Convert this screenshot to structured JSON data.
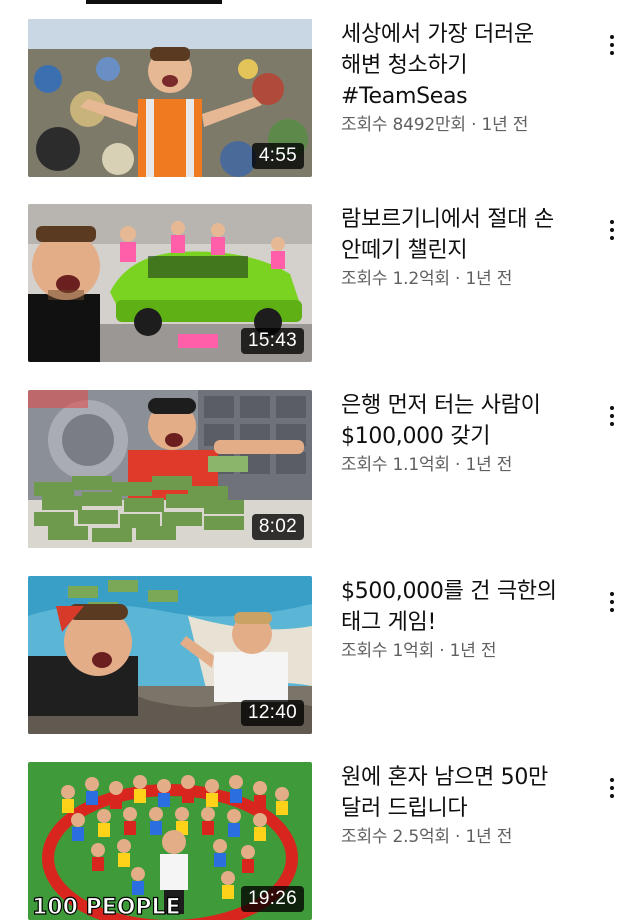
{
  "videos": [
    {
      "title_lines": [
        "세상에서 가장 더러운",
        "해변 청소하기",
        "#TeamSeas"
      ],
      "views": "조회수 8492만회",
      "age": "1년 전",
      "duration": "4:55",
      "more_icon": "more-vert-icon"
    },
    {
      "title_lines": [
        "람보르기니에서 절대 손",
        "안떼기 챌린지"
      ],
      "views": "조회수 1.2억회",
      "age": "1년 전",
      "duration": "15:43",
      "more_icon": "more-vert-icon"
    },
    {
      "title_lines": [
        "은행 먼저 터는 사람이",
        "$100,000 갖기"
      ],
      "views": "조회수 1.1억회",
      "age": "1년 전",
      "duration": "8:02",
      "more_icon": "more-vert-icon"
    },
    {
      "title_lines": [
        "$500,000를 건 극한의",
        "태그 게임!"
      ],
      "views": "조회수 1억회",
      "age": "1년 전",
      "duration": "12:40",
      "more_icon": "more-vert-icon"
    },
    {
      "title_lines": [
        "원에 혼자 남으면 50만",
        "달러 드립니다"
      ],
      "views": "조회수 2.5억회",
      "age": "1년 전",
      "duration": "19:26",
      "thumb_overlay_text": "100 PEOPLE",
      "more_icon": "more-vert-icon"
    }
  ],
  "separator": " · ",
  "colors": {
    "text_primary": "#0f0f0f",
    "text_secondary": "#606060",
    "duration_bg": "#000000"
  }
}
